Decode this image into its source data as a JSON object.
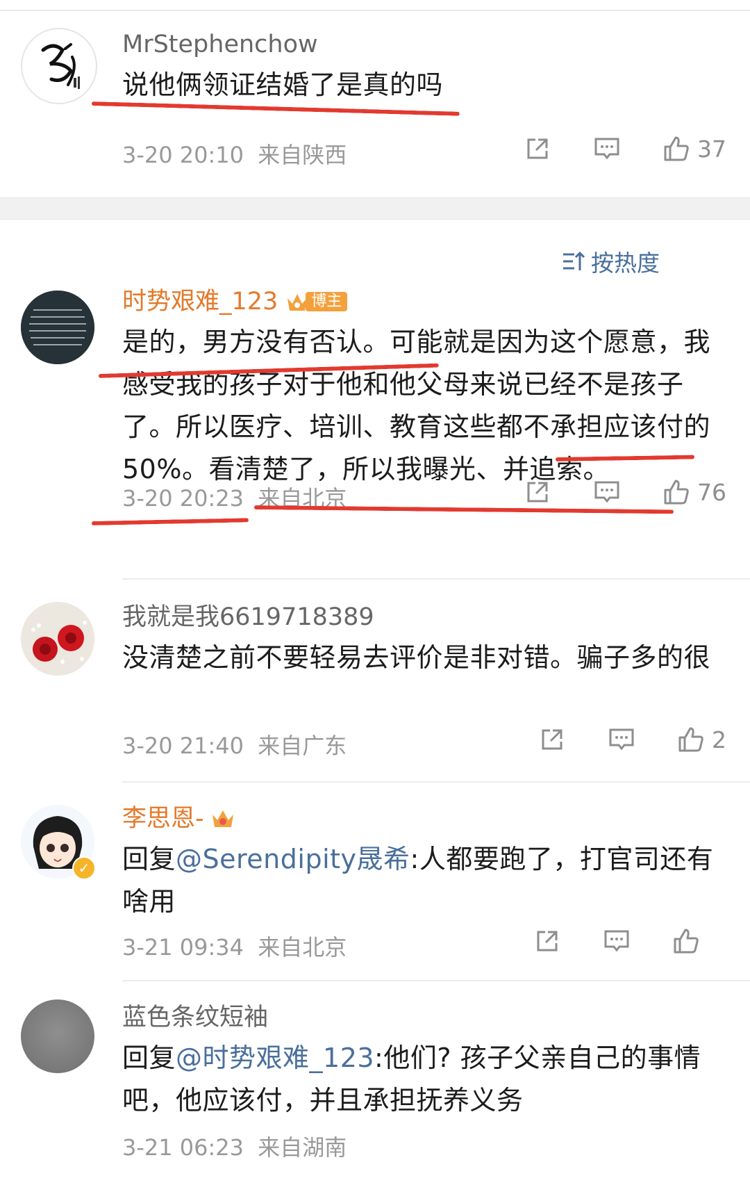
{
  "first_comment": {
    "username": "MrStephenchow",
    "text": "说他俩领证结婚了是真的吗",
    "time": "3-20 20:10",
    "location": "来自陕西",
    "likes": "37"
  },
  "sort_label": "按热度",
  "comments": [
    {
      "username": "时势艰难_123",
      "badge": "博主",
      "text": "是的，男方没有否认。可能就是因为这个愿意，我感受我的孩子对于他和他父母来说已经不是孩子了。所以医疗、培训、教育这些都不承担应该付的50%。看清楚了，所以我曝光、并追索。",
      "time": "3-20 20:23",
      "location": "来自北京",
      "likes": "76"
    },
    {
      "username": "我就是我6619718389",
      "text": "没清楚之前不要轻易去评价是非对错。骗子多的很",
      "time": "3-20 21:40",
      "location": "来自广东",
      "likes": "2"
    },
    {
      "username": "李思恩-",
      "reply_prefix": "回复",
      "mention": "@Serendipity晟希",
      "reply_text": ":人都要跑了，打官司还有啥用",
      "time": "3-21 09:34",
      "location": "来自北京",
      "likes": ""
    },
    {
      "username": "蓝色条纹短袖",
      "reply_prefix": "回复",
      "mention": "@时势艰难_123",
      "reply_text": ":他们? 孩子父亲自己的事情吧，他应该付，并且承担抚养义务",
      "time": "3-21 06:23",
      "location": "来自湖南"
    }
  ],
  "colors": {
    "accent_link": "#4a6f9c",
    "vip_name": "#e37a2b",
    "annotation_red": "#e23a2f"
  }
}
